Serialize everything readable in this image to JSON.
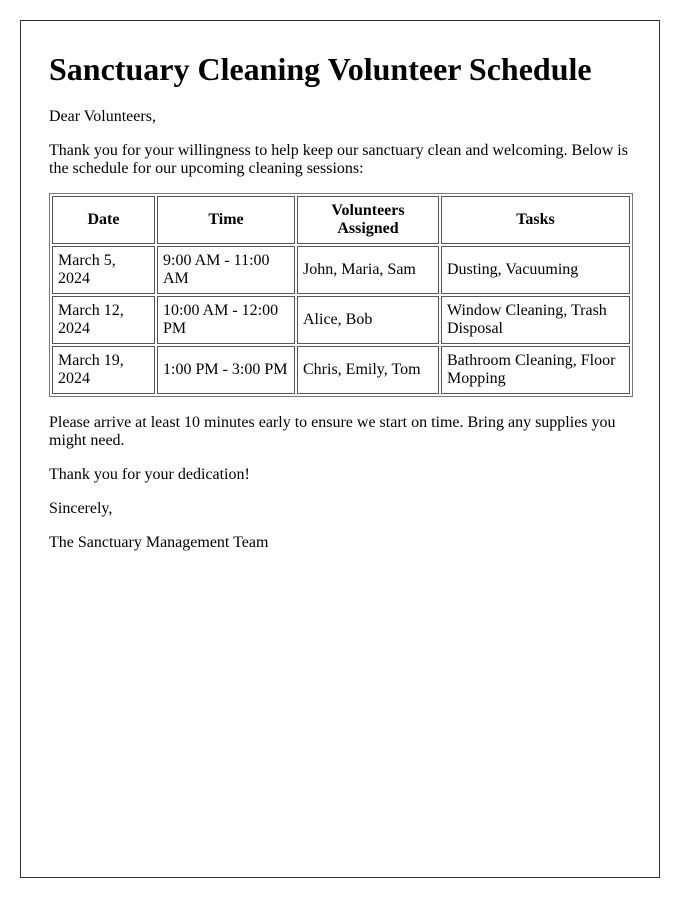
{
  "title": "Sanctuary Cleaning Volunteer Schedule",
  "greeting": "Dear Volunteers,",
  "intro": "Thank you for your willingness to help keep our sanctuary clean and welcoming. Below is the schedule for our upcoming cleaning sessions:",
  "table": {
    "headers": [
      "Date",
      "Time",
      "Volunteers Assigned",
      "Tasks"
    ],
    "rows": [
      [
        "March 5, 2024",
        "9:00 AM - 11:00 AM",
        "John, Maria, Sam",
        "Dusting, Vacuuming"
      ],
      [
        "March 12, 2024",
        "10:00 AM - 12:00 PM",
        "Alice, Bob",
        "Window Cleaning, Trash Disposal"
      ],
      [
        "March 19, 2024",
        "1:00 PM - 3:00 PM",
        "Chris, Emily, Tom",
        "Bathroom Cleaning, Floor Mopping"
      ]
    ]
  },
  "instructions": "Please arrive at least 10 minutes early to ensure we start on time. Bring any supplies you might need.",
  "thanks": "Thank you for your dedication!",
  "closing": "Sincerely,",
  "signature": "The Sanctuary Management Team"
}
